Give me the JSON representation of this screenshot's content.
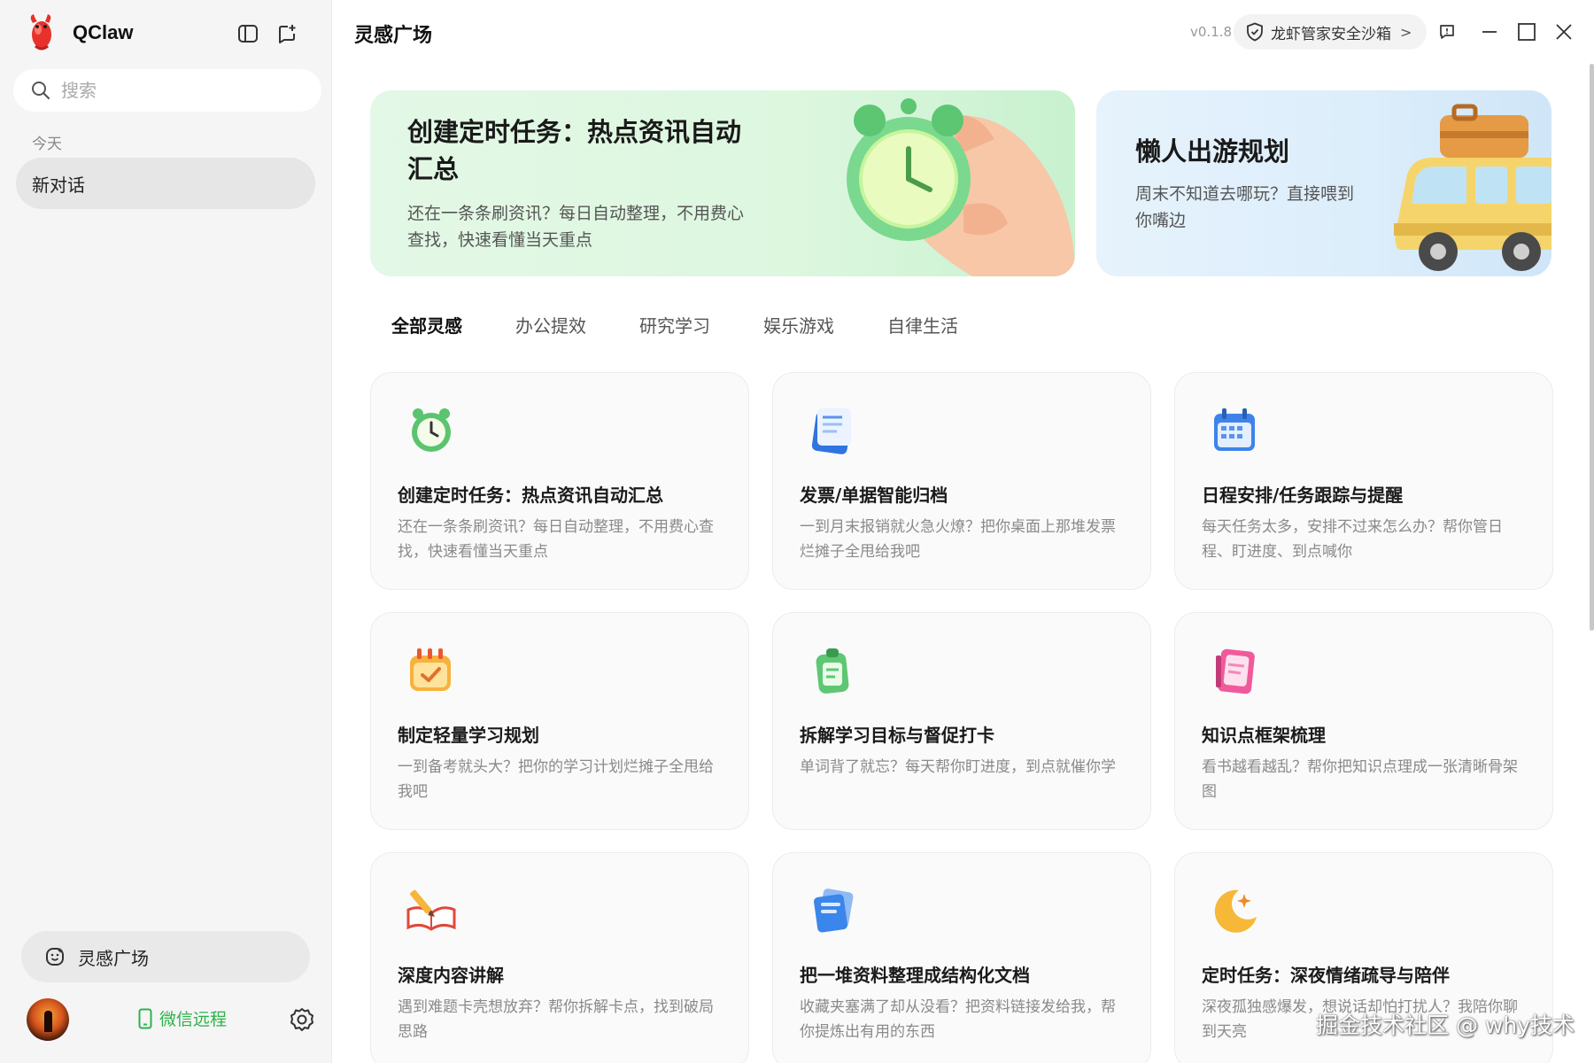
{
  "app": {
    "name": "QClaw",
    "version": "v0.1.8"
  },
  "sidebar": {
    "search_placeholder": "搜索",
    "section_today": "今天",
    "conversations": [
      "新对话"
    ],
    "inspiration_button": "灵感广场",
    "wechat_remote": "微信远程"
  },
  "header": {
    "title": "灵感广场",
    "sandbox_label": "龙虾管家安全沙箱"
  },
  "banners": [
    {
      "title": "创建定时任务：热点资讯自动汇总",
      "desc": "还在一条条刷资讯？每日自动整理，不用费心查找，快速看懂当天重点"
    },
    {
      "title": "懒人出游规划",
      "desc": "周末不知道去哪玩？直接喂到你嘴边"
    }
  ],
  "tabs": [
    "全部灵感",
    "办公提效",
    "研究学习",
    "娱乐游戏",
    "自律生活"
  ],
  "active_tab": "全部灵感",
  "cards": [
    {
      "icon": "alarm-clock-icon",
      "title": "创建定时任务：热点资讯自动汇总",
      "desc": "还在一条条刷资讯？每日自动整理，不用费心查找，快速看懂当天重点"
    },
    {
      "icon": "invoice-icon",
      "title": "发票/单据智能归档",
      "desc": "一到月末报销就火急火燎？把你桌面上那堆发票烂摊子全甩给我吧"
    },
    {
      "icon": "calendar-icon",
      "title": "日程安排/任务跟踪与提醒",
      "desc": "每天任务太多，安排不过来怎么办？帮你管日程、盯进度、到点喊你"
    },
    {
      "icon": "checklist-calendar-icon",
      "title": "制定轻量学习规划",
      "desc": "一到备考就头大？把你的学习计划烂摊子全甩给我吧"
    },
    {
      "icon": "clipboard-icon",
      "title": "拆解学习目标与督促打卡",
      "desc": "单词背了就忘？每天帮你盯进度，到点就催你学"
    },
    {
      "icon": "notebook-icon",
      "title": "知识点框架梳理",
      "desc": "看书越看越乱？帮你把知识点理成一张清晰骨架图"
    },
    {
      "icon": "open-book-pencil-icon",
      "title": "深度内容讲解",
      "desc": "遇到难题卡壳想放弃？帮你拆解卡点，找到破局思路"
    },
    {
      "icon": "documents-stack-icon",
      "title": "把一堆资料整理成结构化文档",
      "desc": "收藏夹塞满了却从没看？把资料链接发给我，帮你提炼出有用的东西"
    },
    {
      "icon": "moon-star-icon",
      "title": "定时任务：深夜情绪疏导与陪伴",
      "desc": "深夜孤独感爆发，想说话却怕打扰人？我陪你聊到天亮"
    }
  ],
  "watermark": "掘金技术社区 @ why技术",
  "colors": {
    "accent_green": "#2cb34a",
    "banner_green": "#ddf7df",
    "banner_blue": "#dcedfb"
  }
}
